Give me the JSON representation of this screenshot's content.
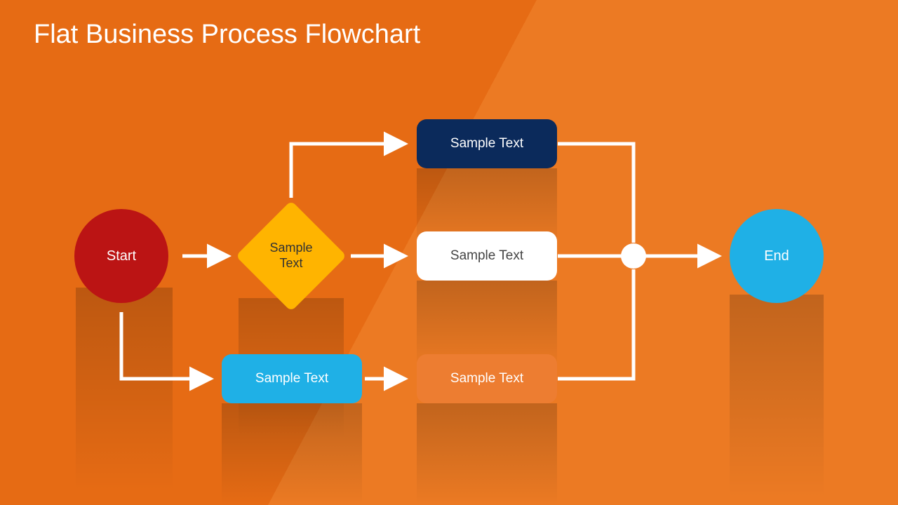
{
  "title": "Flat Business Process Flowchart",
  "nodes": {
    "start_label": "Start",
    "decision_label": "Sample Text",
    "proc_top_label": "Sample Text",
    "proc_mid_label": "Sample Text",
    "proc_bottom_right_label": "Sample Text",
    "proc_bottom_left_label": "Sample Text",
    "end_label": "End"
  },
  "colors": {
    "background": "#e66b14",
    "background_light": "#ec7a23",
    "start": "#bb1414",
    "decision": "#ffb400",
    "navy": "#0b2a5b",
    "white": "#ffffff",
    "orange_box": "#ed7d31",
    "blue": "#1fb0e6",
    "connector": "#ffffff"
  }
}
